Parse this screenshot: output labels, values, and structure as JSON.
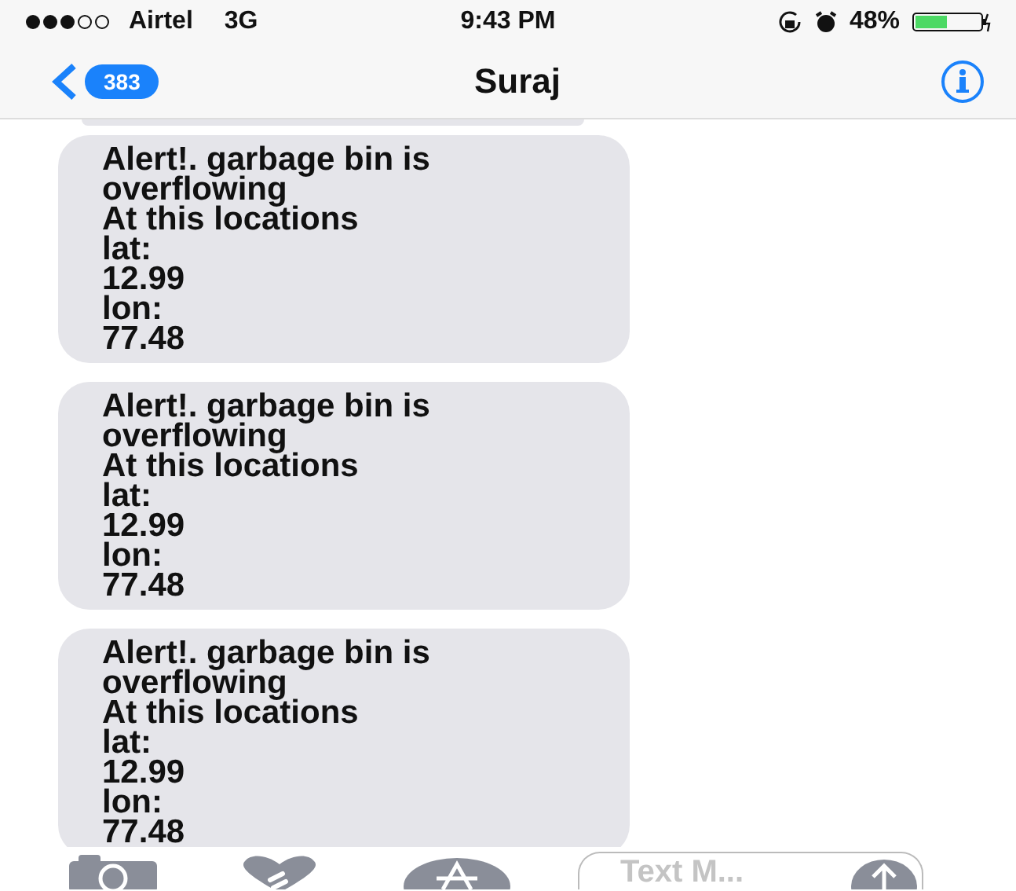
{
  "status_bar": {
    "carrier": "Airtel",
    "network": "3G",
    "time": "9:43 PM",
    "battery": "48%"
  },
  "nav": {
    "back_count": "383",
    "title": "Suraj"
  },
  "messages": [
    {
      "text": "Alert!. garbage bin is overflowing\nAt this locations\nlat:\n12.99\nlon:\n77.48"
    },
    {
      "text": "Alert!. garbage bin is overflowing\nAt this locations\nlat:\n12.99\nlon:\n77.48"
    },
    {
      "text": "Alert!. garbage bin is overflowing\nAt this locations\nlat:\n12.99\nlon:\n77.48"
    }
  ],
  "composer": {
    "placeholder": "Text M..."
  }
}
